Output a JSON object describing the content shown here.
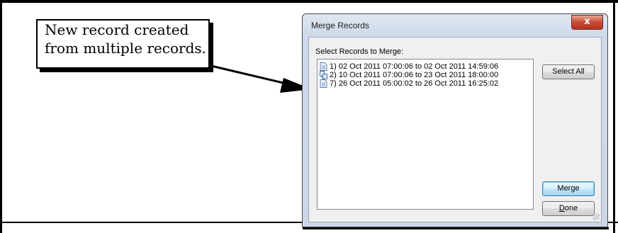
{
  "callout": {
    "line1": "New record created",
    "line2": "from multiple records."
  },
  "dialog": {
    "title": "Merge Records",
    "close_label": "x",
    "list_label": "Select Records to Merge:",
    "records": [
      {
        "text": "1) 02 Oct 2011  07:00:06 to 02 Oct 2011  14:59:06",
        "icon": "document-icon"
      },
      {
        "text": "2) 10 Oct 2011  07:00:06 to 23 Oct 2011  18:00:00",
        "icon": "merged-documents-icon"
      },
      {
        "text": "7) 26 Oct 2011  05:00:02 to 26 Oct 2011  16:25:02",
        "icon": "document-icon"
      }
    ],
    "buttons": {
      "select_all": "Select All",
      "merge": "Merge",
      "done_prefix": "D",
      "done_rest": "one"
    }
  },
  "colors": {
    "title_bar": "#cfdaea",
    "close_button": "#c94a35",
    "default_button_border": "#3c7fb1"
  }
}
